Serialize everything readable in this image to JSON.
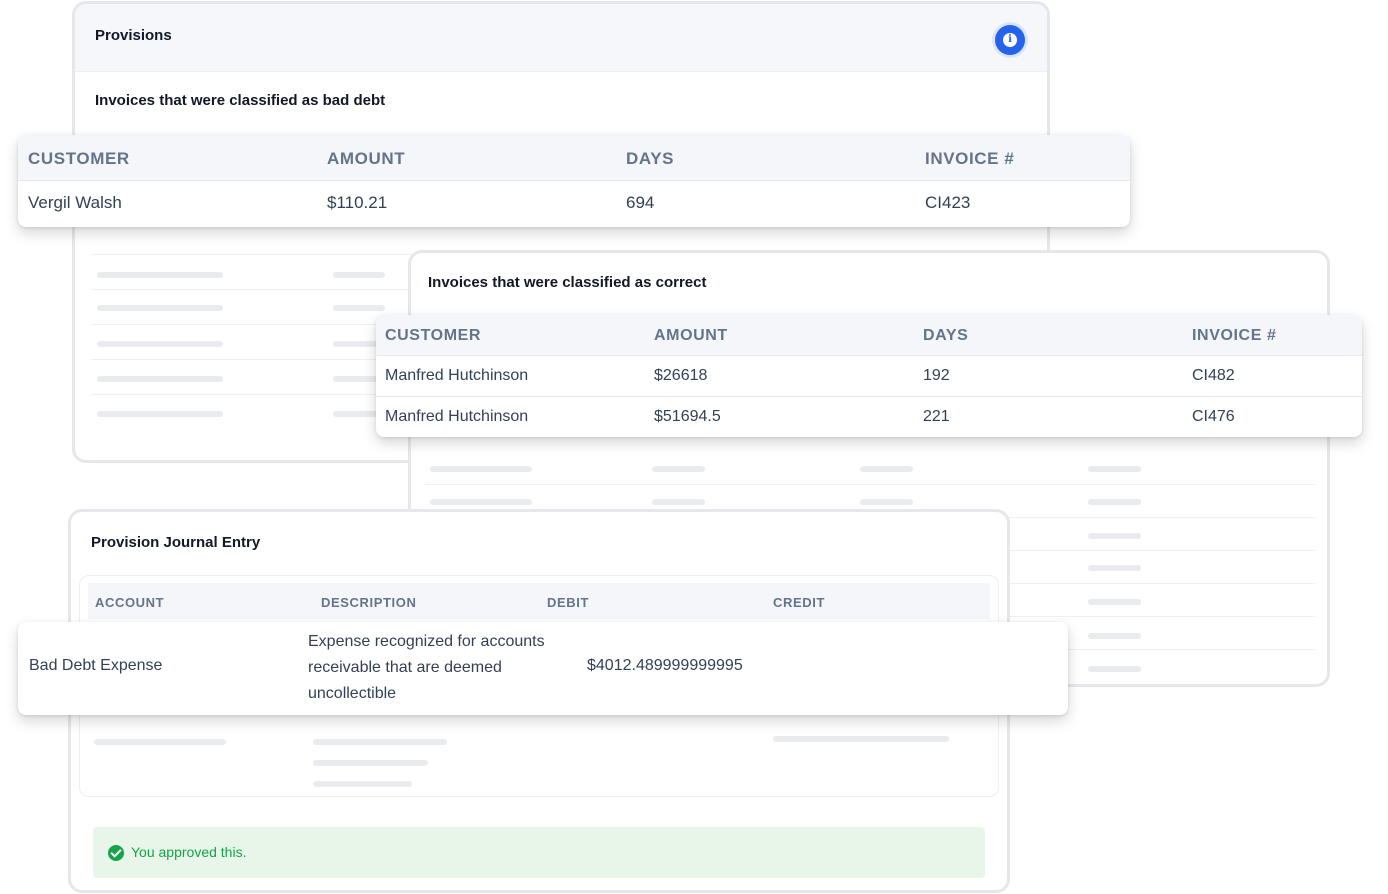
{
  "provisions": {
    "title": "Provisions",
    "bad_debt_subtitle": "Invoices that were classified as bad debt"
  },
  "bad_debt_table": {
    "headers": [
      "CUSTOMER",
      "AMOUNT",
      "DAYS",
      "INVOICE #"
    ],
    "rows": [
      {
        "customer": "Vergil Walsh",
        "amount": "$110.21",
        "days": "694",
        "invoice": "CI423"
      }
    ]
  },
  "correct_table": {
    "subtitle": "Invoices that were classified as correct",
    "headers": [
      "CUSTOMER",
      "AMOUNT",
      "DAYS",
      "INVOICE #"
    ],
    "rows": [
      {
        "customer": "Manfred Hutchinson",
        "amount": "$26618",
        "days": "192",
        "invoice": "CI482"
      },
      {
        "customer": "Manfred Hutchinson",
        "amount": "$51694.5",
        "days": "221",
        "invoice": "CI476"
      }
    ]
  },
  "journal": {
    "title": "Provision Journal Entry",
    "headers": [
      "ACCOUNT",
      "DESCRIPTION",
      "DEBIT",
      "CREDIT"
    ],
    "row": {
      "account": "Bad Debt Expense",
      "description": [
        "Expense recognized for accounts",
        "receivable that are deemed",
        "uncollectible"
      ],
      "debit": "$4012.489999999995",
      "credit": ""
    }
  },
  "approval": {
    "text": "You approved this.",
    "color": "#16a34a"
  },
  "colors": {
    "accent": "#2563eb",
    "approved_bg": "#e8f6ea"
  }
}
